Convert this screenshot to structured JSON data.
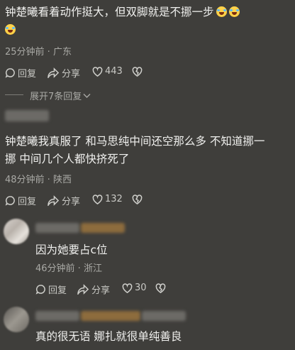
{
  "comments": [
    {
      "text_line1": "钟楚曦看着动作挺大，但双脚就是不挪一步",
      "emoji_icon": "rofl-emoji-icon",
      "meta": "25分钟前 · 广东",
      "reply_label": "回复",
      "share_label": "分享",
      "like_count": "443"
    },
    {
      "text_line1": "钟楚曦我真服了 和马思纯中间还空那么多 不知道挪一",
      "text_line2": "挪 中间几个人都快挤死了",
      "meta": "48分钟前 · 陕西",
      "reply_label": "回复",
      "share_label": "分享",
      "like_count": "132"
    }
  ],
  "expand_replies": "展开7条回复",
  "replies": [
    {
      "text": "因为她要占c位",
      "meta": "46分钟前 · 浙江",
      "reply_label": "回复",
      "share_label": "分享",
      "like_count": "30"
    },
    {
      "text": "真的很无语 娜扎就很单纯善良"
    }
  ],
  "colors": {
    "background": "#3f3e3b",
    "text": "#f0f0ee",
    "meta": "#a9a9a5"
  }
}
